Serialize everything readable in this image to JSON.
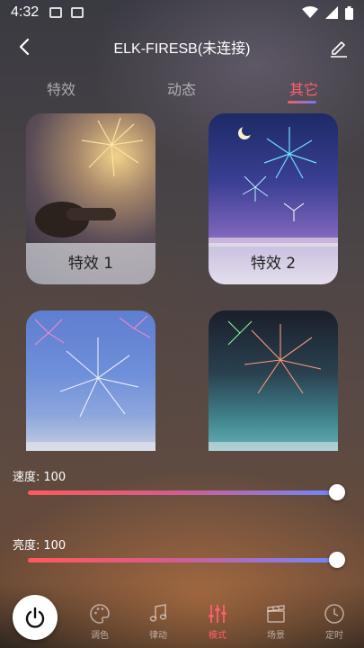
{
  "status_bar": {
    "time": "4:32"
  },
  "header": {
    "title": "ELK-FIRESB(未连接)"
  },
  "tabs": [
    {
      "label": "特效"
    },
    {
      "label": "动态"
    },
    {
      "label": "其它",
      "active": true
    }
  ],
  "cards": [
    {
      "label": "特效 1"
    },
    {
      "label": "特效 2"
    },
    {
      "label": ""
    },
    {
      "label": ""
    }
  ],
  "sliders": {
    "speed": {
      "label": "速度:",
      "value": "100",
      "level": 1.0
    },
    "brightness": {
      "label": "亮度:",
      "value": "100",
      "level": 1.0
    }
  },
  "bottom_nav": [
    {
      "label": "调色",
      "icon": "palette-icon"
    },
    {
      "label": "律动",
      "icon": "music-note-icon"
    },
    {
      "label": "模式",
      "icon": "sliders-icon",
      "active": true
    },
    {
      "label": "场景",
      "icon": "clapperboard-icon"
    },
    {
      "label": "定时",
      "icon": "clock-icon"
    }
  ],
  "colors": {
    "accent": "#ff5f6d",
    "gradient_start": "#ff5a5a",
    "gradient_end": "#6f86ff"
  }
}
